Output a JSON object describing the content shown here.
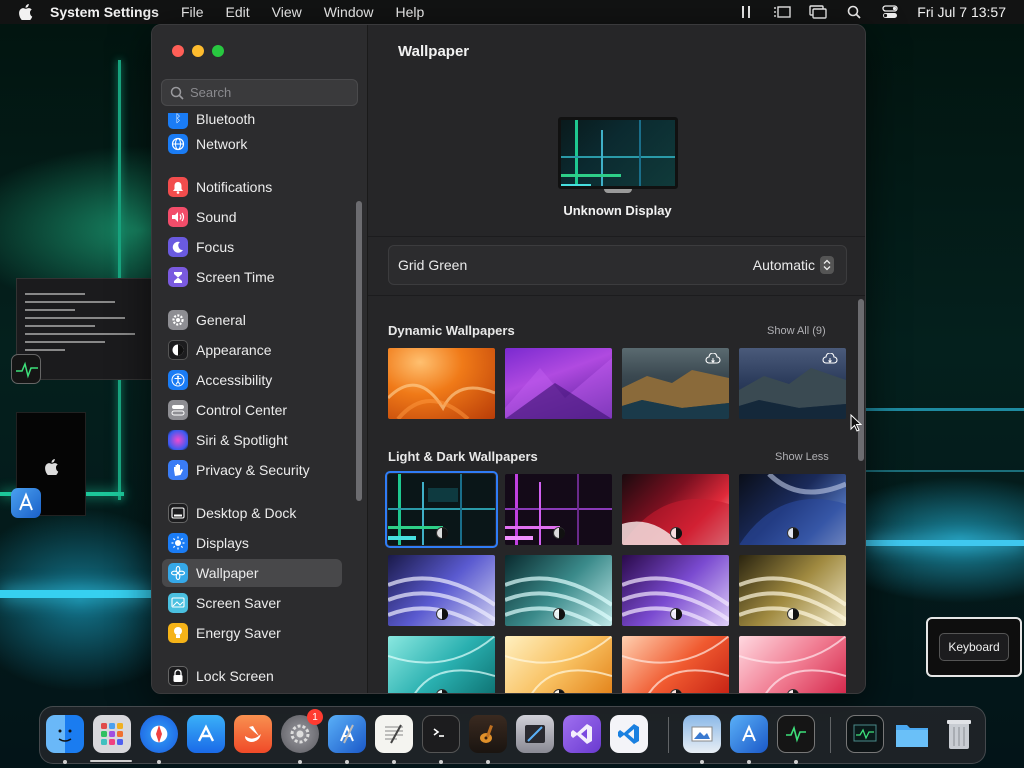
{
  "menubar": {
    "app_name": "System Settings",
    "items": [
      "File",
      "Edit",
      "View",
      "Window",
      "Help"
    ],
    "clock": "Fri Jul 7  13:57",
    "status_icons": [
      "divider-icon",
      "stage-manager-icon",
      "screen-mirroring-icon",
      "spotlight-search-icon",
      "control-center-icon"
    ]
  },
  "window": {
    "search": {
      "placeholder": "Search"
    },
    "sidebar": {
      "items": [
        {
          "label": "Bluetooth",
          "icon": "bluetooth-icon",
          "color": "#1a7cf5"
        },
        {
          "label": "Network",
          "icon": "globe-icon",
          "color": "#1a7cf5"
        },
        {
          "label": "Notifications",
          "icon": "bell-icon",
          "color": "#f24d4d"
        },
        {
          "label": "Sound",
          "icon": "speaker-icon",
          "color": "#f24d6a"
        },
        {
          "label": "Focus",
          "icon": "moon-icon",
          "color": "#6a5ae0"
        },
        {
          "label": "Screen Time",
          "icon": "hourglass-icon",
          "color": "#7a5ae0"
        },
        {
          "label": "General",
          "icon": "gear-icon",
          "color": "#8e8e93"
        },
        {
          "label": "Appearance",
          "icon": "appearance-icon",
          "color": "#1c1c1e"
        },
        {
          "label": "Accessibility",
          "icon": "accessibility-icon",
          "color": "#1a7cf5"
        },
        {
          "label": "Control Center",
          "icon": "toggles-icon",
          "color": "#8e8e93"
        },
        {
          "label": "Siri & Spotlight",
          "icon": "siri-icon",
          "color": "#b040d0"
        },
        {
          "label": "Privacy & Security",
          "icon": "hand-icon",
          "color": "#3a7cf5"
        },
        {
          "label": "Desktop & Dock",
          "icon": "dock-icon",
          "color": "#1c1c1e"
        },
        {
          "label": "Displays",
          "icon": "sun-icon",
          "color": "#1a7cf5"
        },
        {
          "label": "Wallpaper",
          "icon": "flower-icon",
          "color": "#35a8e8"
        },
        {
          "label": "Screen Saver",
          "icon": "screensaver-icon",
          "color": "#4ac0e0"
        },
        {
          "label": "Energy Saver",
          "icon": "bulb-icon",
          "color": "#f5b318"
        },
        {
          "label": "Lock Screen",
          "icon": "lock-icon",
          "color": "#1c1c1e"
        }
      ],
      "selected": "Wallpaper"
    },
    "main": {
      "title": "Wallpaper",
      "display_name": "Unknown Display",
      "current_wallpaper": "Grid Green",
      "mode_select": "Automatic",
      "sections": [
        {
          "title": "Dynamic Wallpapers",
          "link": "Show All (9)",
          "thumbs": [
            "ventura-orange",
            "monterey-purple",
            "catalina-coast",
            "catalina-evening"
          ]
        },
        {
          "title": "Light & Dark Wallpapers",
          "link": "Show Less",
          "thumbs": [
            "grid-green",
            "grid-purple",
            "ventura-red",
            "ventura-blue",
            "sonoma-purple",
            "sonoma-teal",
            "sonoma-violet",
            "sonoma-gold",
            "imac-teal",
            "imac-orange",
            "imac-red",
            "imac-pink"
          ]
        }
      ]
    }
  },
  "tooltip": {
    "label": "Keyboard"
  },
  "dock": {
    "apps": [
      {
        "name": "finder-icon"
      },
      {
        "name": "launchpad-icon"
      },
      {
        "name": "safari-icon"
      },
      {
        "name": "app-store-icon"
      },
      {
        "name": "swift-icon"
      },
      {
        "name": "system-settings-icon",
        "badge": "1"
      },
      {
        "name": "xcode-icon"
      },
      {
        "name": "textedit-icon"
      },
      {
        "name": "terminal-icon"
      },
      {
        "name": "garageband-icon"
      },
      {
        "name": "instruments-icon"
      },
      {
        "name": "visual-studio-icon"
      },
      {
        "name": "vscode-icon"
      },
      {
        "name": "preview-icon"
      },
      {
        "name": "simulator-icon"
      },
      {
        "name": "activity-monitor-icon"
      },
      {
        "name": "activity-monitor-window-icon"
      },
      {
        "name": "downloads-folder-icon"
      },
      {
        "name": "trash-icon"
      }
    ]
  }
}
